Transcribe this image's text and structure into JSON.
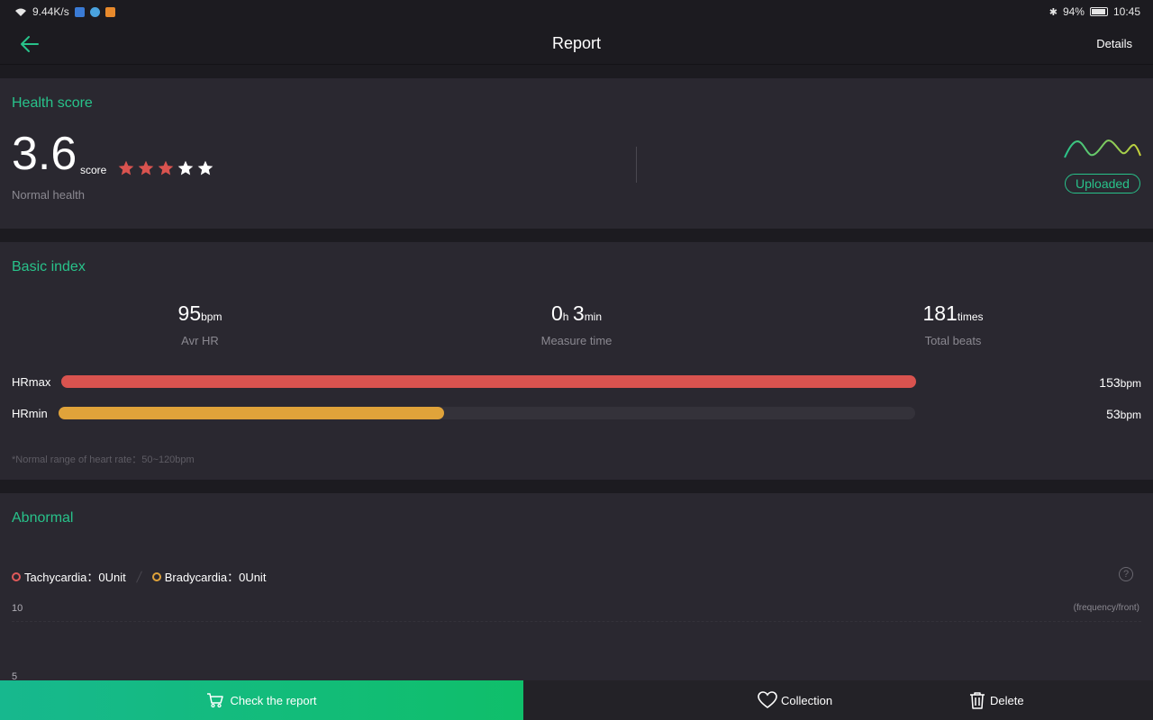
{
  "status_bar": {
    "network_speed": "9.44K/s",
    "battery": "94%",
    "battery_level": 0.94,
    "time": "10:45",
    "icons": [
      "wifi-icon",
      "bluetooth-icon",
      "battery-icon"
    ]
  },
  "header": {
    "title": "Report",
    "details_label": "Details",
    "icons": {
      "back": "arrow-left-icon"
    }
  },
  "health": {
    "section_title": "Health score",
    "score": "3.6",
    "score_unit": "score",
    "stars_filled": 3,
    "stars_total": 5,
    "status": "Normal health",
    "upload_status": "Uploaded"
  },
  "basic": {
    "section_title": "Basic index",
    "avg_hr": {
      "value": "95",
      "unit": "bpm",
      "label": "Avr HR"
    },
    "measure_time": {
      "hours": "0",
      "hours_unit": "h",
      "minutes": "3",
      "minutes_unit": "min",
      "label": "Measure time"
    },
    "total_beats": {
      "value": "181",
      "unit": "times",
      "label": "Total beats"
    },
    "hr_max": {
      "label": "HRmax",
      "value": "153",
      "unit": "bpm",
      "fraction": 1.0
    },
    "hr_min": {
      "label": "HRmin",
      "value": "53",
      "unit": "bpm",
      "fraction": 0.45
    },
    "note": "*Normal range of heart rate：50~120bpm"
  },
  "abnormal": {
    "section_title": "Abnormal",
    "tachycardia": "Tachycardia：0Unit",
    "bradycardia": "Bradycardia：0Unit",
    "y_top": "10",
    "y_mid": "5",
    "y_unit": "(frequency/front)"
  },
  "bottom": {
    "check_label": "Check the report",
    "collection_label": "Collection",
    "delete_label": "Delete"
  },
  "colors": {
    "accent": "#28c28a",
    "hrmax": "#d9534f",
    "hrmin": "#e0a33a",
    "star_filled": "#d9534f",
    "star_empty": "#ffffff",
    "tachy_dot": "#e05a5a",
    "brady_dot": "#e0a33a"
  }
}
